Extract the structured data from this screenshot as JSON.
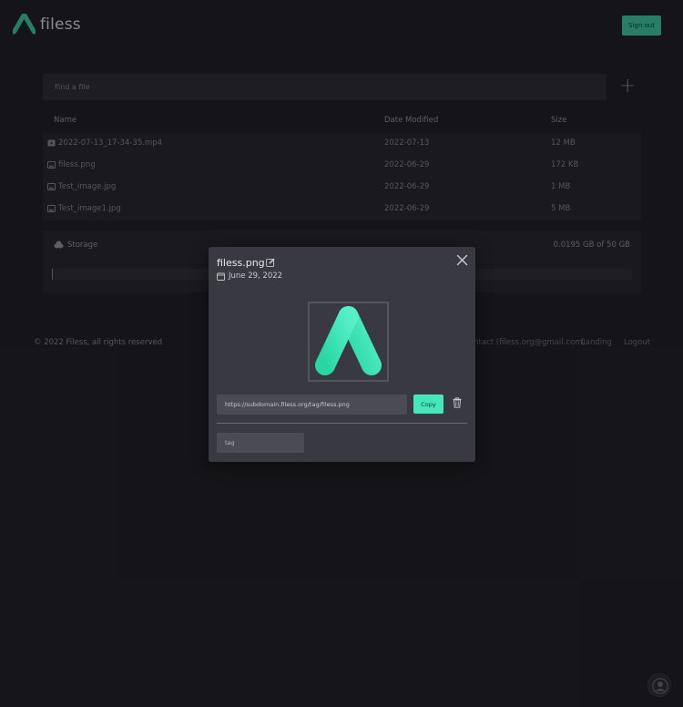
{
  "header": {
    "brand": "filess",
    "signout_label": "Sign out"
  },
  "search": {
    "placeholder": "Find a file"
  },
  "table": {
    "columns": {
      "name": "Name",
      "date": "Date Modified",
      "size": "Size"
    },
    "rows": [
      {
        "icon": "video-file-icon",
        "name": "2022-07-13_17-34-35.mp4",
        "date": "2022-07-13",
        "size": "12 MB"
      },
      {
        "icon": "image-file-icon",
        "name": "filess.png",
        "date": "2022-06-29",
        "size": "172 KB"
      },
      {
        "icon": "image-file-icon",
        "name": "Test_image.jpg",
        "date": "2022-06-29",
        "size": "1 MB"
      },
      {
        "icon": "image-file-icon",
        "name": "Test_image1.jpg",
        "date": "2022-06-29",
        "size": "5 MB"
      }
    ]
  },
  "storage": {
    "label": "Storage",
    "value": "0.0195 GB of 50 GB",
    "used_fraction": 0.0004
  },
  "footer": {
    "copyright": "© 2022 Filess, all rights reserved",
    "contact": "Contact (filess.org@gmail.com)",
    "landing": "Landing",
    "logout": "Logout"
  },
  "modal": {
    "title": "filess.png",
    "date": "June 29, 2022",
    "url": "https://subdomain.filess.org/tag/filess.png",
    "copy_label": "Copy",
    "tag_placeholder": "tag"
  },
  "colors": {
    "accent": "#3fd0a6",
    "background": "#1e1e23",
    "modal": "#393a41"
  }
}
